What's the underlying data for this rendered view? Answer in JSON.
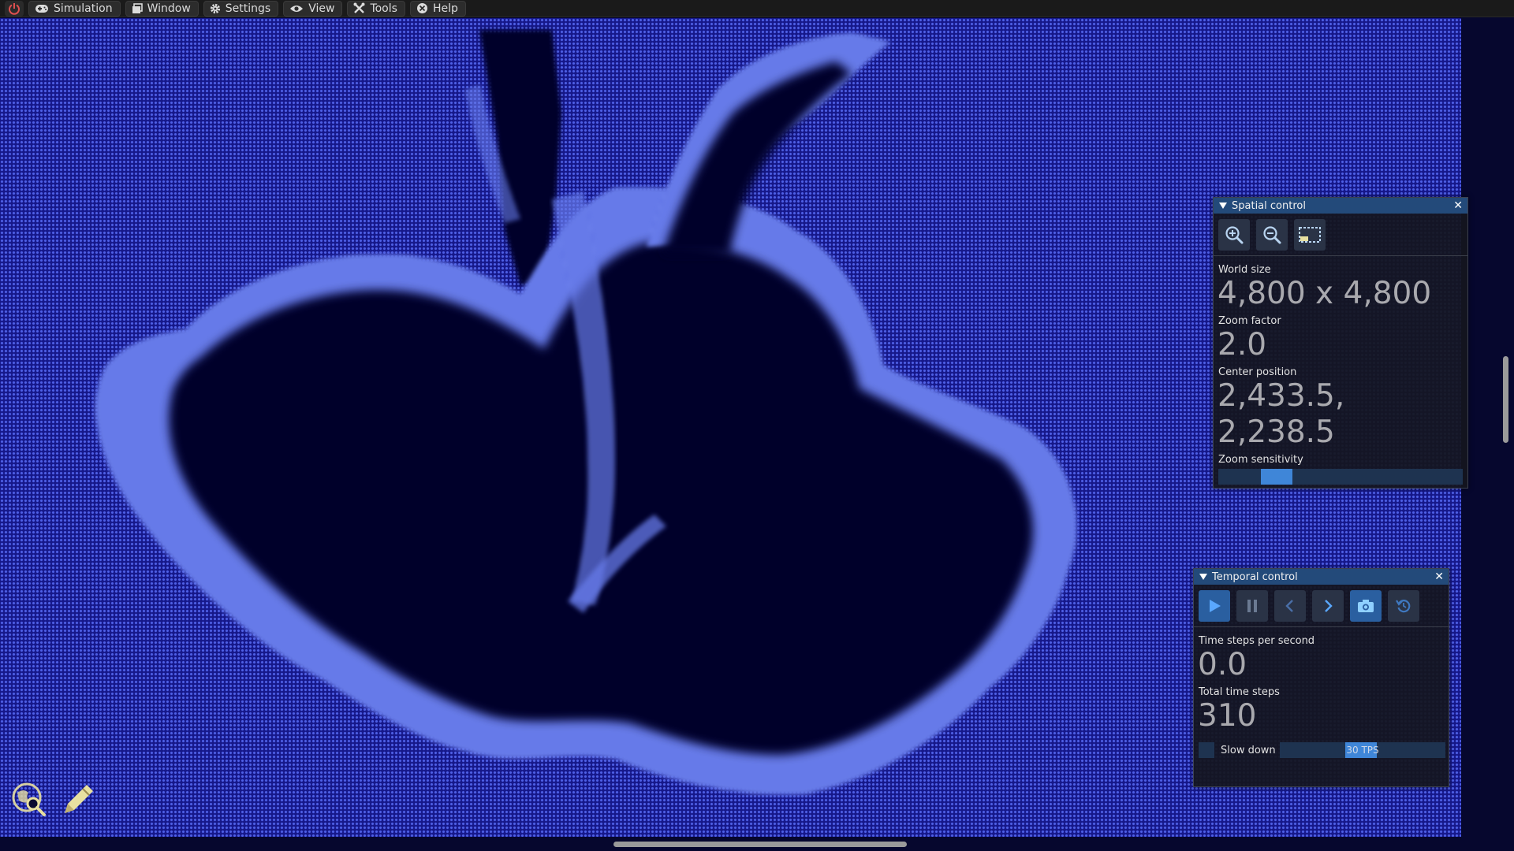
{
  "menu": {
    "items": [
      {
        "label": "Simulation",
        "icon": "gamepad-icon"
      },
      {
        "label": "Window",
        "icon": "window-icon"
      },
      {
        "label": "Settings",
        "icon": "gear-icon"
      },
      {
        "label": "View",
        "icon": "eye-icon"
      },
      {
        "label": "Tools",
        "icon": "tools-icon"
      },
      {
        "label": "Help",
        "icon": "help-icon"
      }
    ],
    "power_icon": "power-icon",
    "power_color": "#e05050"
  },
  "colors": {
    "world_background": "#16188a",
    "particles": "#4e5fe6",
    "particle_highlight": "#8aa0ff",
    "void": "#03042a",
    "panel_title": "#234a7a",
    "accent": "#3f86d8",
    "tool_icon": "#e8e0a0"
  },
  "spatial_panel": {
    "title": "Spatial control",
    "buttons": [
      "zoom-in-icon",
      "zoom-out-icon",
      "selection-rectangle-icon"
    ],
    "world_size_label": "World size",
    "world_size_value": "4,800 x 4,800",
    "zoom_factor_label": "Zoom factor",
    "zoom_factor_value": "2.0",
    "center_position_label": "Center position",
    "center_position_value": "2,433.5, 2,238.5",
    "zoom_sensitivity_label": "Zoom sensitivity",
    "zoom_sensitivity_level": 0.2
  },
  "temporal_panel": {
    "title": "Temporal control",
    "buttons": [
      "play-icon",
      "pause-icon",
      "step-back-icon",
      "step-forward-icon",
      "snapshot-icon",
      "restore-icon"
    ],
    "tps_label": "Time steps per second",
    "tps_value": "0.0",
    "total_steps_label": "Total time steps",
    "total_steps_value": "310",
    "slow_down_label": "Slow down",
    "slow_down_checked": false,
    "slow_down_tps": "30 TPS",
    "slow_down_level": 0.45
  },
  "tools": [
    "inspect-icon",
    "pencil-icon"
  ]
}
